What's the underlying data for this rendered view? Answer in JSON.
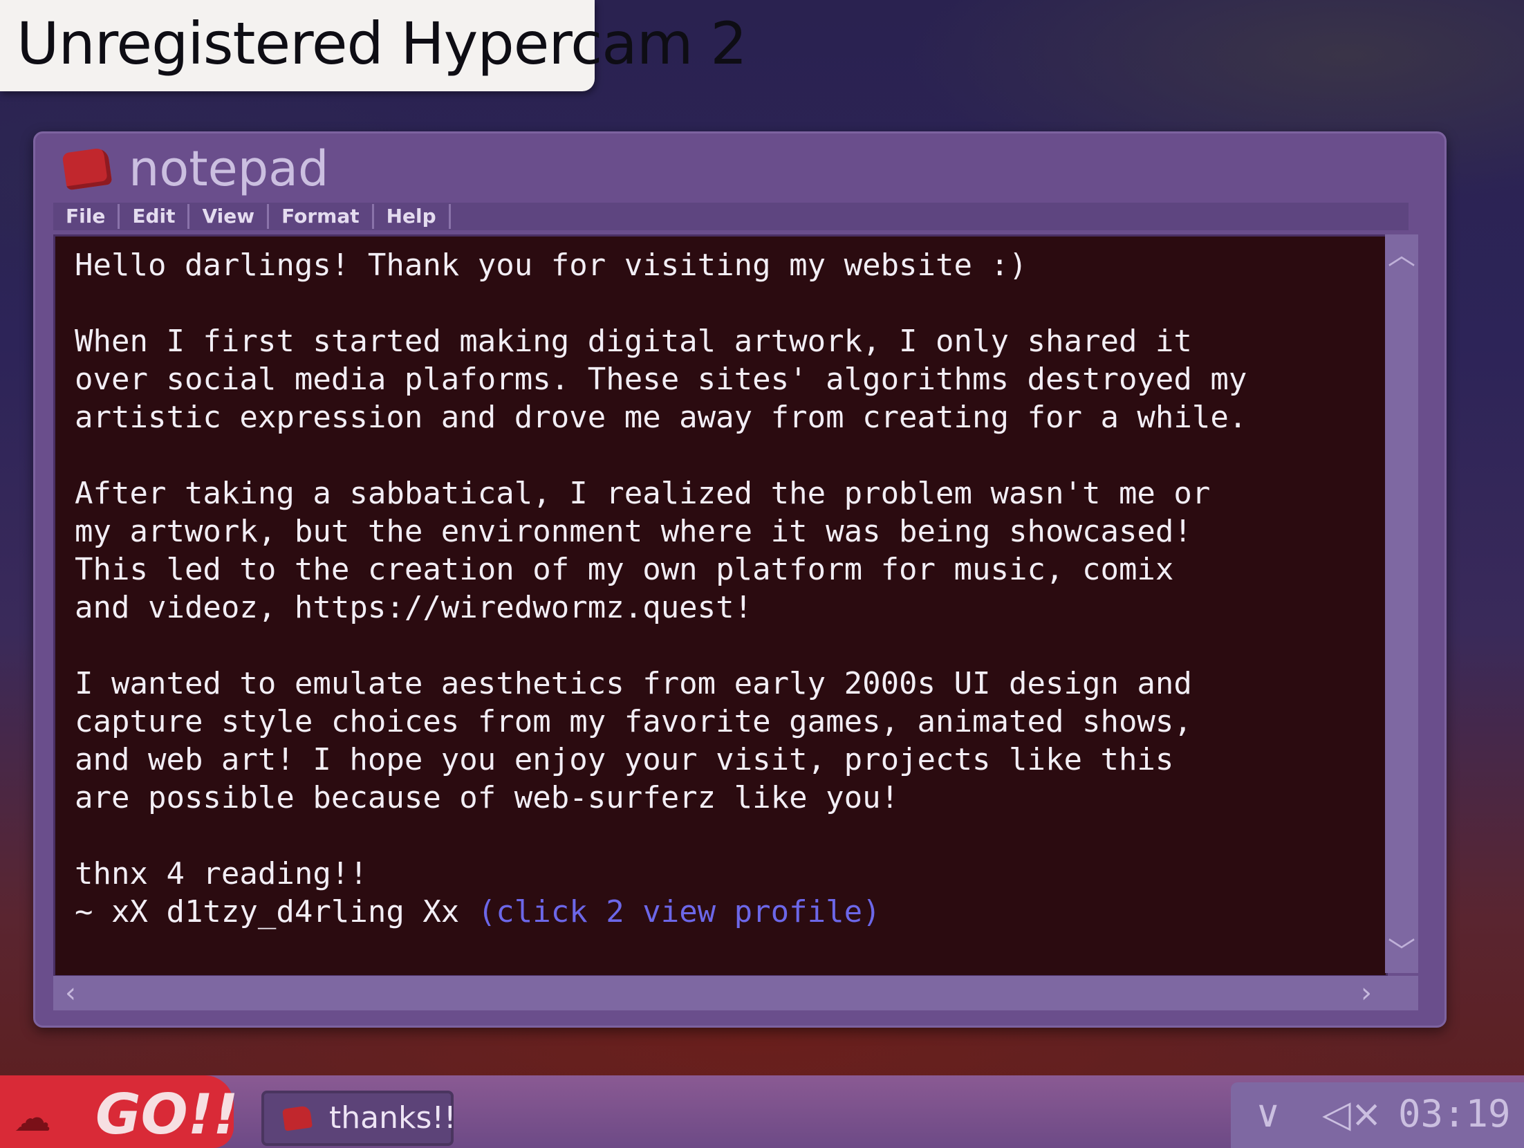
{
  "watermark": {
    "text": "Unregistered Hypercam 2"
  },
  "window": {
    "title": "notepad",
    "menu": [
      "File",
      "Edit",
      "View",
      "Format",
      "Help"
    ],
    "body": "Hello darlings! Thank you for visiting my website :)\n\nWhen I first started making digital artwork, I only shared it\nover social media plaforms. These sites' algorithms destroyed my\nartistic expression and drove me away from creating for a while.\n\nAfter taking a sabbatical, I realized the problem wasn't me or\nmy artwork, but the environment where it was being showcased!\nThis led to the creation of my own platform for music, comix\nand videoz, https://wiredwormz.quest!\n\nI wanted to emulate aesthetics from early 2000s UI design and\ncapture style choices from my favorite games, animated shows,\nand web art! I hope you enjoy your visit, projects like this\nare possible because of web-surferz like you!\n\nthnx 4 reading!!\n~ xX d1tzy_d4rling Xx ",
    "profile_link": "(click 2 view profile)"
  },
  "taskbar": {
    "go_label": "GO!!",
    "task_label": "thanks!!",
    "clock": "03:19"
  },
  "colors": {
    "accent_red": "#d92a37",
    "window_purple": "#6a4e8c",
    "content_bg": "#2b0b10",
    "link": "#6c67e8"
  },
  "icons": [
    "notepad-icon",
    "cloud-icon",
    "chevron-down-icon",
    "mute-icon",
    "scroll-up-icon",
    "scroll-down-icon",
    "scroll-left-icon",
    "scroll-right-icon"
  ]
}
